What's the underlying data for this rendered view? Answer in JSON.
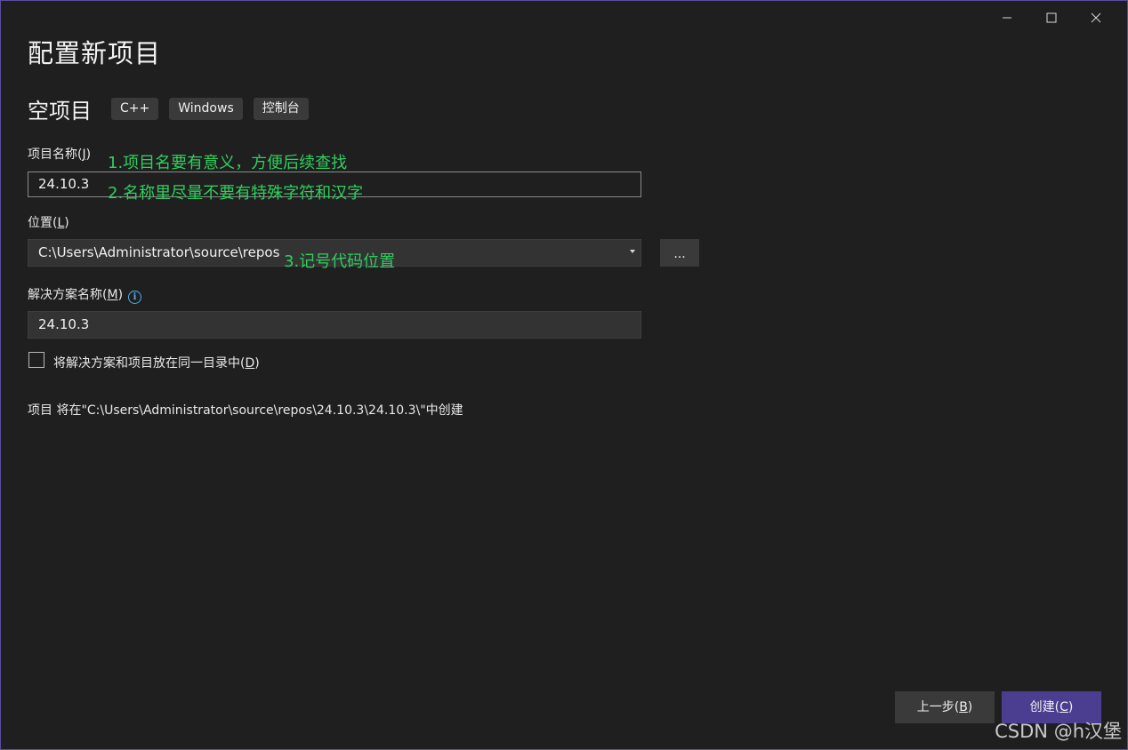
{
  "window": {
    "title": "配置新项目",
    "controls": {
      "minimize": "minimize-icon",
      "maximize": "maximize-icon",
      "close": "close-icon"
    }
  },
  "template": {
    "name": "空项目",
    "tags": [
      "C++",
      "Windows",
      "控制台"
    ]
  },
  "project_name": {
    "label": "项目名称(",
    "accel": "J",
    "label_end": ")",
    "value": "24.10.3"
  },
  "location": {
    "label": "位置(",
    "accel": "L",
    "label_end": ")",
    "value": "C:\\Users\\Administrator\\source\\repos",
    "browse_label": "..."
  },
  "solution_name": {
    "label": "解决方案名称(",
    "accel": "M",
    "label_end": ")",
    "value": "24.10.3"
  },
  "same_dir": {
    "label": "将解决方案和项目放在同一目录中(",
    "accel": "D",
    "label_end": ")",
    "checked": false
  },
  "path_note": "项目 将在\"C:\\Users\\Administrator\\source\\repos\\24.10.3\\24.10.3\\\"中创建",
  "annotations": {
    "note1": "1.项目名要有意义，方便后续查找",
    "note2": "2.名称里尽量不要有特殊字符和汉字",
    "note3": "3.记号代码位置"
  },
  "buttons": {
    "back": "上一步(",
    "back_accel": "B",
    "back_end": ")",
    "create": "创建(",
    "create_accel": "C",
    "create_end": ")"
  },
  "watermark": "CSDN @h汉堡",
  "colors": {
    "background": "#1f1f1f",
    "accent": "#4b3e91",
    "annotation": "#2fcf5e",
    "info": "#4fb0f0"
  }
}
